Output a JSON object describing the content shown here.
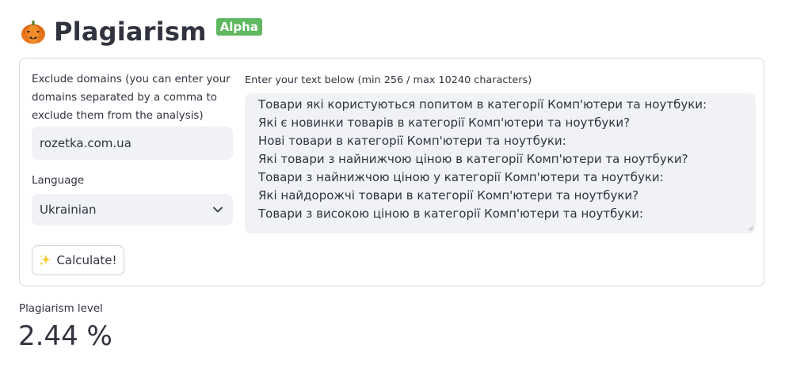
{
  "header": {
    "title": "Plagiarism",
    "badge": "Alpha",
    "logo_icon": "pumpkin-icon"
  },
  "form": {
    "exclude_label": "Exclude domains (you can enter your domains separated by a comma to exclude them from the analysis)",
    "exclude_value": "rozetka.com.ua",
    "language_label": "Language",
    "language_selected": "Ukrainian",
    "text_label": "Enter your text below (min 256 / max 10240 characters)",
    "text_lines": [
      "Товари які користуються попитом в категорії Комп'ютери та ноутбуки:",
      "Які є новинки товарів в категорії Комп'ютери та ноутбуки?",
      "Нові товари в категорії Комп'ютери та ноутбуки:",
      "Які товари з найнижчою ціною в категорії Комп'ютери та ноутбуки?",
      "Товари з найнижчою ціною у категорії Комп'ютери та ноутбуки:",
      "Які найдорожчі товари в категорії Комп'ютери та ноутбуки?",
      "Товари з високою ціною в категорії Комп'ютери та ноутбуки:"
    ],
    "calculate_label": "Calculate!",
    "calculate_icon": "sparkle-icon"
  },
  "result": {
    "label": "Plagiarism level",
    "value": "2.44 %"
  },
  "colors": {
    "badge": "#5fb760",
    "field_bg": "#f0f2f6",
    "text": "#31333f",
    "border": "#d7d9df"
  }
}
